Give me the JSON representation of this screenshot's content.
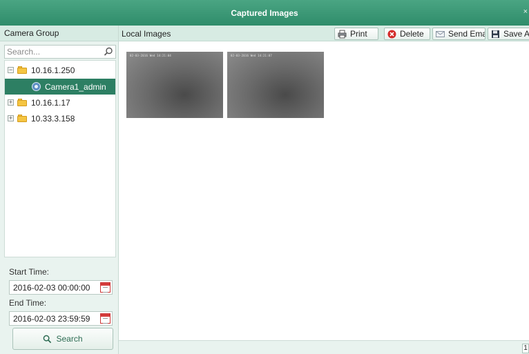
{
  "window": {
    "title": "Captured Images",
    "close_glyph": "×"
  },
  "left_panel": {
    "header": "Camera Group",
    "search": {
      "placeholder": "Search...",
      "icon": "search-icon"
    },
    "tree": [
      {
        "label": "10.16.1.250",
        "expander": "−",
        "expanded": true,
        "type": "folder"
      },
      {
        "label": "Camera1_admin",
        "type": "camera",
        "selected": true
      },
      {
        "label": "10.16.1.17",
        "expander": "+",
        "expanded": false,
        "type": "folder"
      },
      {
        "label": "10.33.3.158",
        "expander": "+",
        "expanded": false,
        "type": "folder"
      }
    ],
    "start_time": {
      "label": "Start Time:",
      "value": "2016-02-03 00:00:00"
    },
    "end_time": {
      "label": "End Time:",
      "value": "2016-02-03 23:59:59"
    },
    "search_button": "Search"
  },
  "main": {
    "header": "Local Images",
    "toolbar": {
      "print": "Print",
      "delete": "Delete",
      "send_email": "Send Email",
      "save_as": "Save As"
    },
    "images": [
      {
        "osd": "02-03-2016 Wed 14:21:04"
      },
      {
        "osd": "02-03-2016 Wed 14:21:07"
      }
    ],
    "page": "1"
  },
  "colors": {
    "title_bar": "#3a9a76",
    "selected_row": "#2d7f63",
    "panel_bg": "#e9f3ef",
    "header_bg": "#d7ebe3"
  }
}
